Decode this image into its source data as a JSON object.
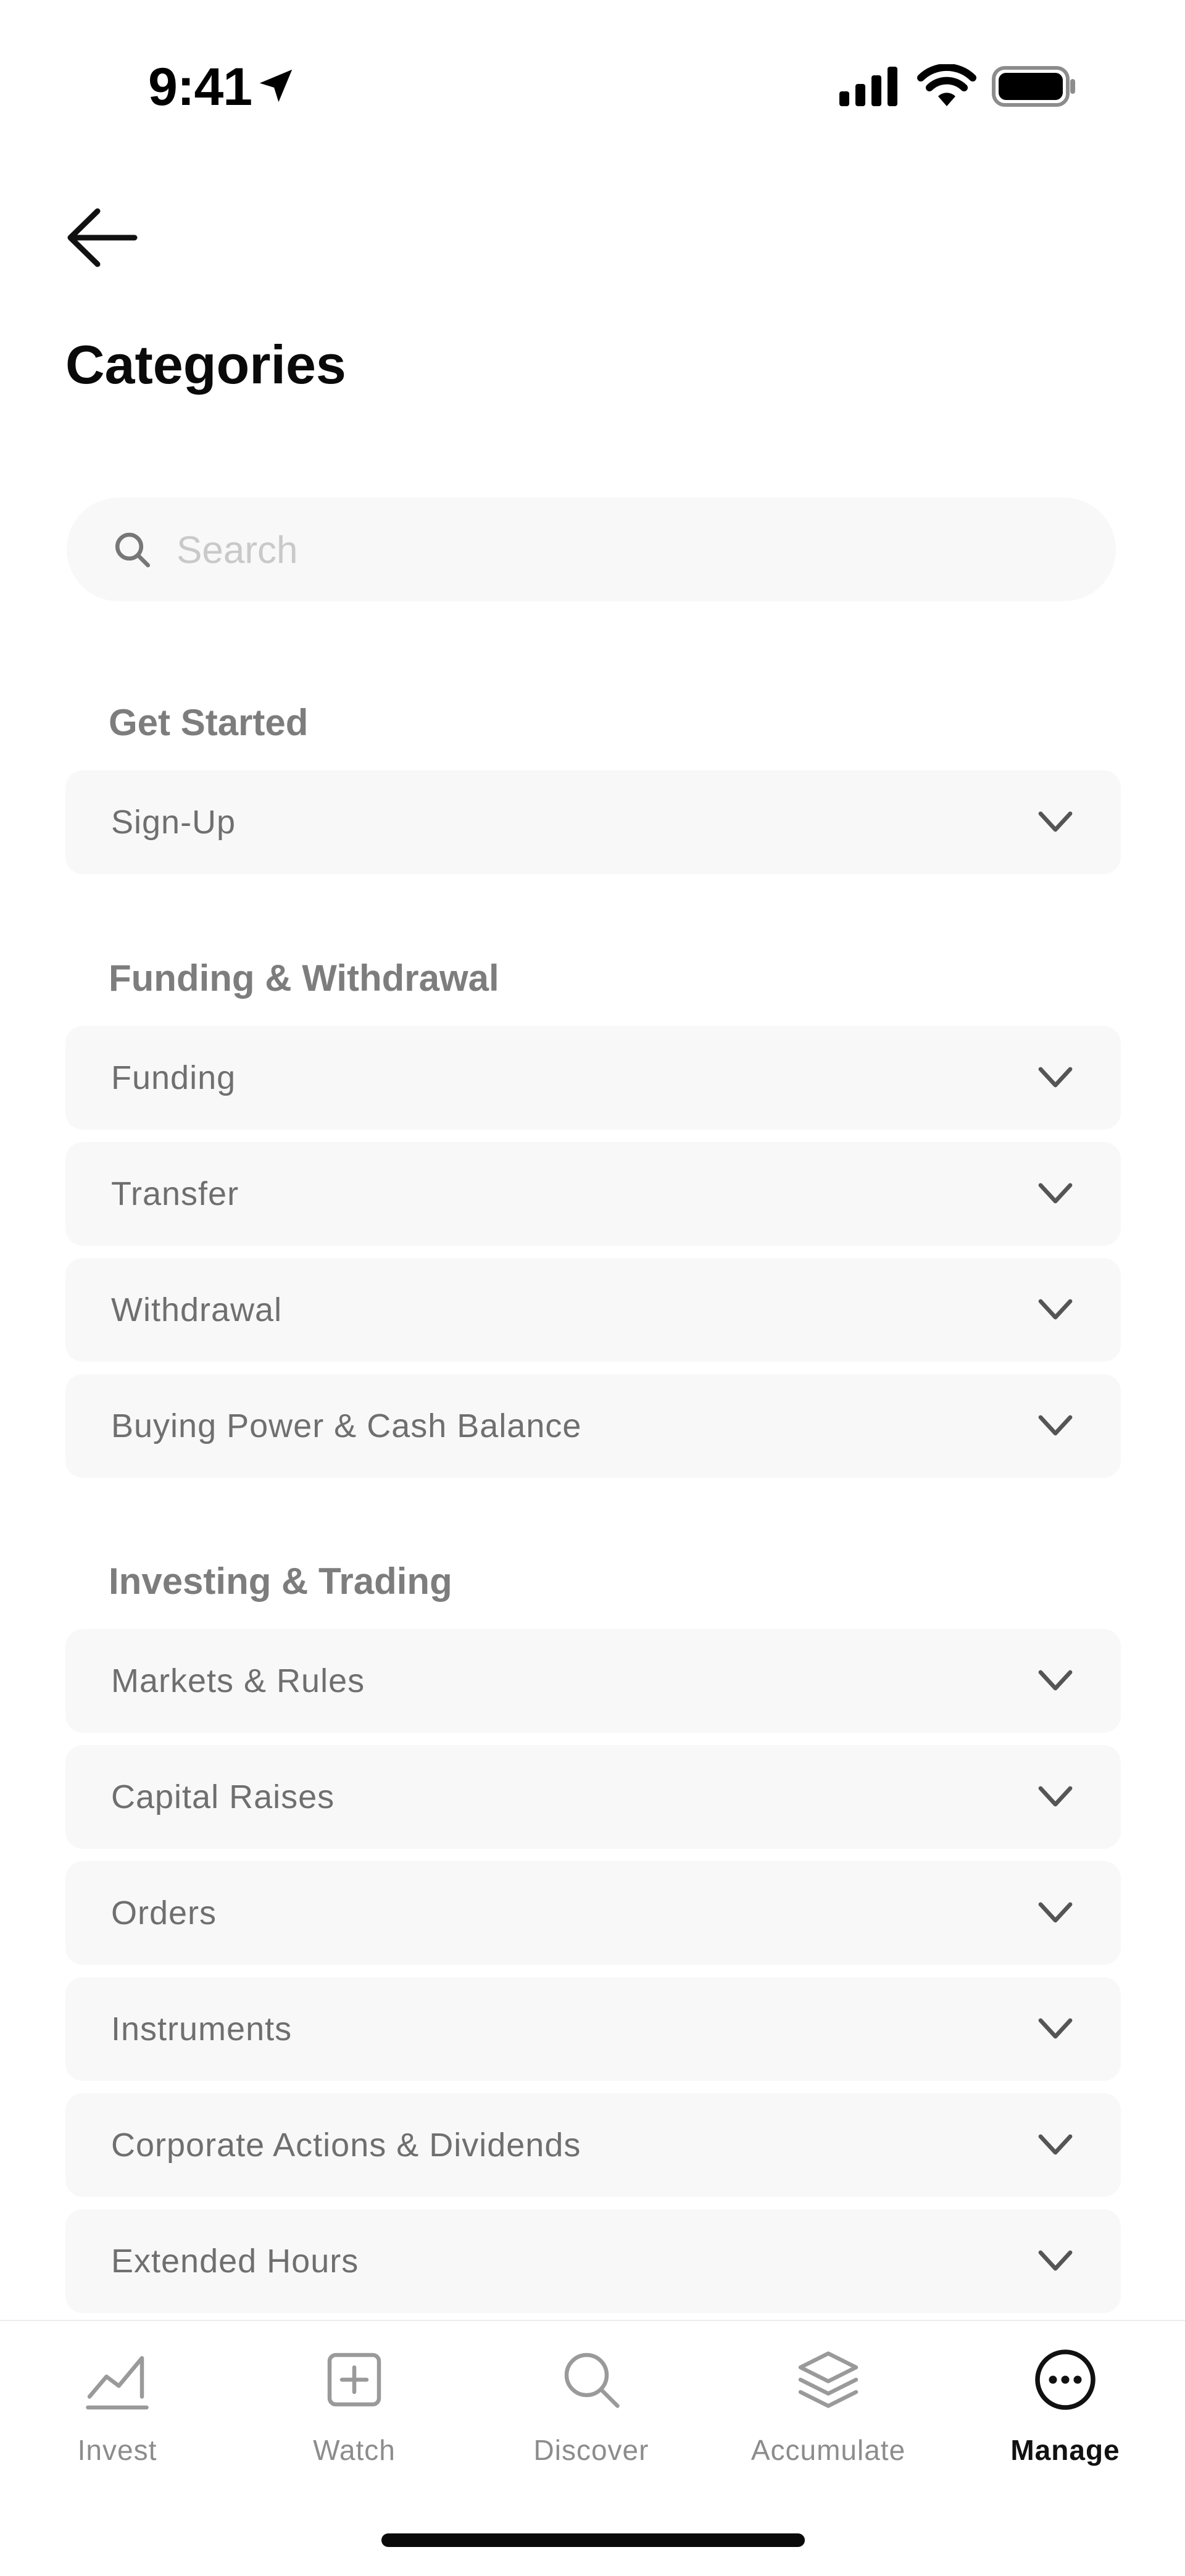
{
  "status_bar": {
    "time": "9:41",
    "icons": [
      "location-arrow-icon",
      "cellular-signal-icon",
      "wifi-icon",
      "battery-icon"
    ]
  },
  "header": {
    "back_icon": "arrow-left-icon",
    "title": "Categories"
  },
  "search": {
    "placeholder": "Search",
    "value": "",
    "icon": "search-icon"
  },
  "sections": [
    {
      "title": "Get Started",
      "items": [
        {
          "label": "Sign-Up"
        }
      ]
    },
    {
      "title": "Funding & Withdrawal",
      "items": [
        {
          "label": "Funding"
        },
        {
          "label": "Transfer"
        },
        {
          "label": "Withdrawal"
        },
        {
          "label": "Buying Power & Cash Balance"
        }
      ]
    },
    {
      "title": "Investing & Trading",
      "items": [
        {
          "label": "Markets & Rules"
        },
        {
          "label": "Capital Raises"
        },
        {
          "label": "Orders"
        },
        {
          "label": "Instruments"
        },
        {
          "label": "Corporate Actions & Dividends"
        },
        {
          "label": "Extended Hours"
        }
      ]
    }
  ],
  "bottom_nav": {
    "items": [
      {
        "label": "Invest",
        "icon": "chart-line-icon",
        "active": false
      },
      {
        "label": "Watch",
        "icon": "plus-square-icon",
        "active": false
      },
      {
        "label": "Discover",
        "icon": "search-icon",
        "active": false
      },
      {
        "label": "Accumulate",
        "icon": "layers-icon",
        "active": false
      },
      {
        "label": "Manage",
        "icon": "more-circle-icon",
        "active": true
      }
    ]
  },
  "colors": {
    "background": "#ffffff",
    "row_background": "#f8f8f8",
    "section_title": "#7d7d7d",
    "row_label": "#6f6f6f",
    "inactive_nav": "#8c8c8c",
    "active_nav": "#111111"
  }
}
